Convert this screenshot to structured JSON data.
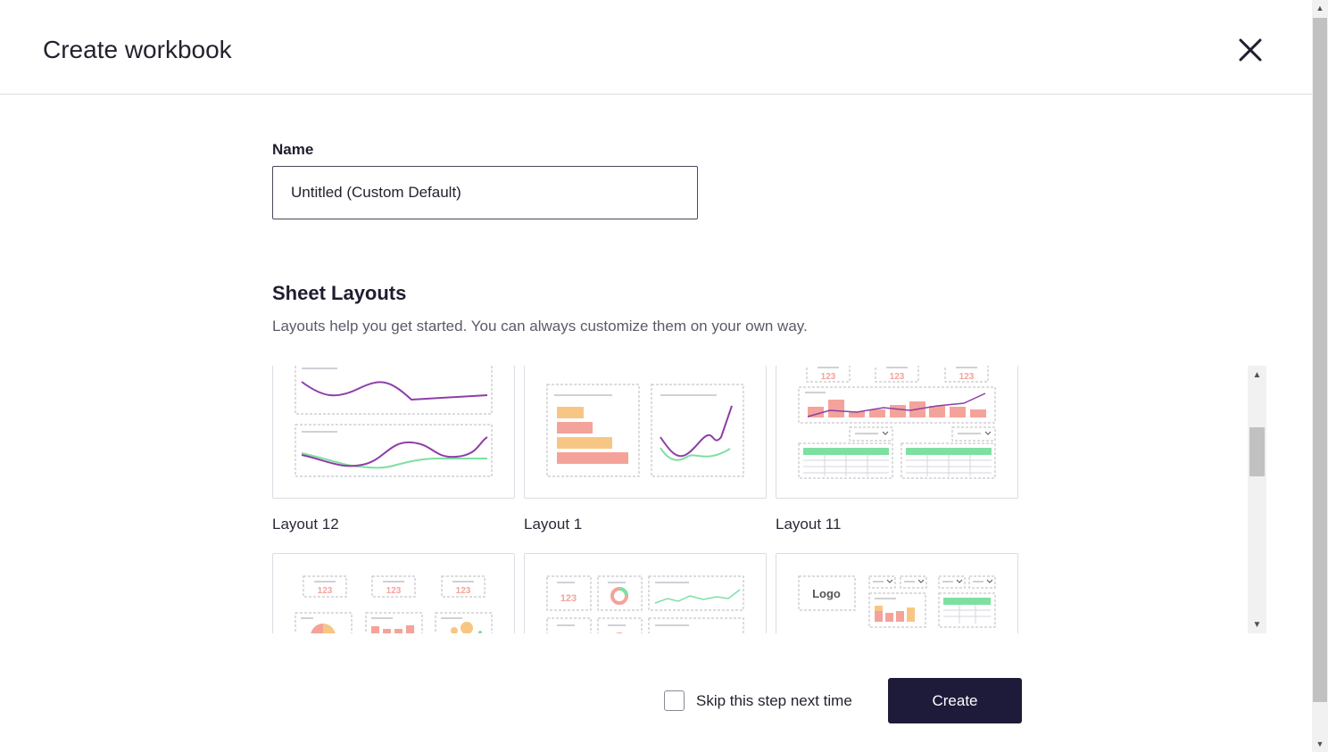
{
  "dialog": {
    "title": "Create workbook",
    "close_icon": "close-icon"
  },
  "name_field": {
    "label": "Name",
    "value": "Untitled (Custom Default)"
  },
  "layouts_section": {
    "title": "Sheet Layouts",
    "description": "Layouts help you get started. You can always customize them on your own way.",
    "layouts": [
      {
        "label": "Layout 12"
      },
      {
        "label": "Layout 1"
      },
      {
        "label": "Layout 11"
      },
      {
        "label": ""
      },
      {
        "label": ""
      },
      {
        "label": ""
      }
    ],
    "thumbnail_text": {
      "kpi": "123",
      "logo": "Logo"
    }
  },
  "footer": {
    "skip_label": "Skip this step next time",
    "skip_checked": false,
    "create_label": "Create"
  },
  "colors": {
    "primary": "#1e1b3a",
    "purple": "#8e3ea6",
    "green": "#7ee0a0",
    "salmon": "#f4a39a",
    "orange": "#f8c684"
  }
}
